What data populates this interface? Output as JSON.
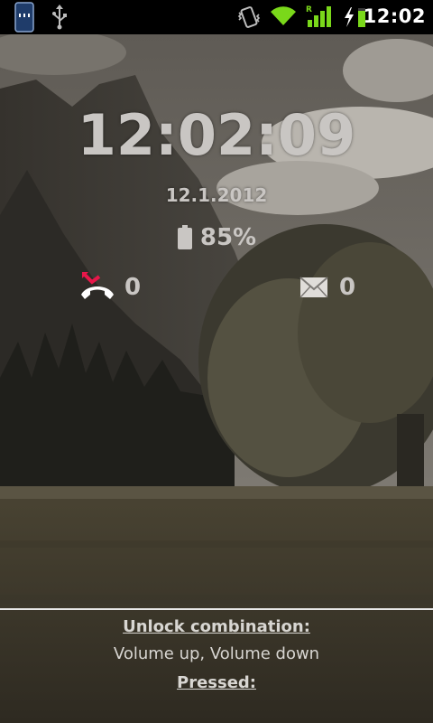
{
  "status_bar": {
    "time": "12:02",
    "icons": [
      "app-notification-icon",
      "usb-icon",
      "vibrate-icon",
      "wifi-icon",
      "signal-icon",
      "charging-icon",
      "battery-icon"
    ],
    "signal_tag": "R"
  },
  "lockscreen": {
    "clock": "12:02:09",
    "date": "12.1.2012",
    "battery_percent": "85%",
    "missed_calls": "0",
    "messages": "0"
  },
  "bottom_panel": {
    "unlock_heading": "Unlock combination:",
    "unlock_combination": "Volume up, Volume down",
    "pressed_heading": "Pressed:"
  },
  "colors": {
    "overlay_text": "#c9c6c3",
    "missed_call_accent": "#e8174a",
    "wifi_green": "#7ad81a",
    "status_bar_bg": "#000000"
  }
}
